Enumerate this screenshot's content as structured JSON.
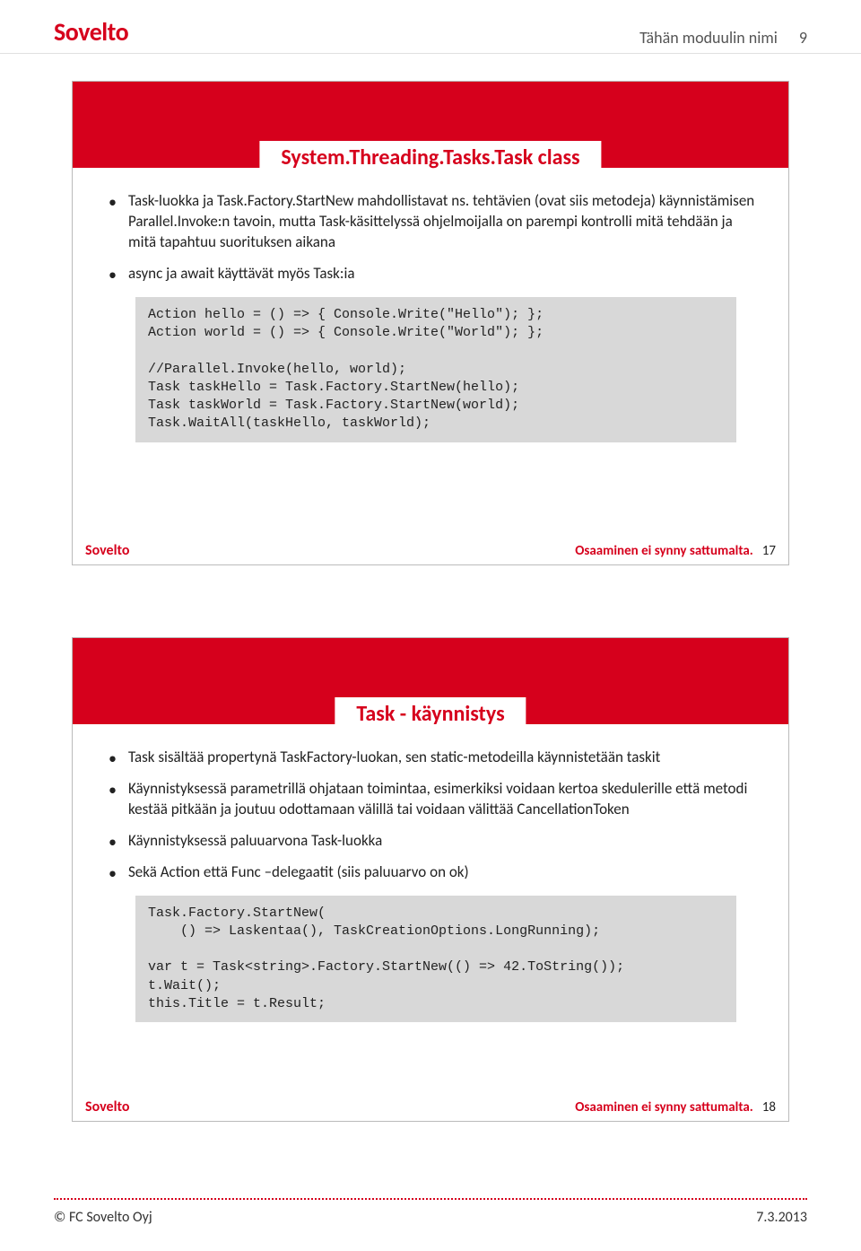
{
  "header": {
    "logo": "Sovelto",
    "module_label": "Tähän moduulin nimi",
    "page_number": "9"
  },
  "slides": [
    {
      "title": "System.Threading.Tasks.Task class",
      "bullets": [
        "Task-luokka ja Task.Factory.StartNew mahdollistavat ns. tehtävien (ovat siis metodeja) käynnistämisen Parallel.Invoke:n tavoin, mutta Task-käsittelyssä ohjelmoijalla on parempi kontrolli mitä tehdään ja mitä tapahtuu suorituksen aikana",
        "async ja await käyttävät myös Task:ia"
      ],
      "code": "Action hello = () => { Console.Write(\"Hello\"); };\nAction world = () => { Console.Write(\"World\"); };\n\n//Parallel.Invoke(hello, world);\nTask taskHello = Task.Factory.StartNew(hello);\nTask taskWorld = Task.Factory.StartNew(world);\nTask.WaitAll(taskHello, taskWorld);",
      "footer_logo": "Sovelto",
      "footer_slogan": "Osaaminen ei synny sattumalta.",
      "slide_number": "17"
    },
    {
      "title": "Task - käynnistys",
      "bullets": [
        "Task sisältää propertynä TaskFactory-luokan, sen static-metodeilla käynnistetään taskit",
        "Käynnistyksessä parametrillä ohjataan toimintaa, esimerkiksi voidaan kertoa skedulerille että metodi kestää pitkään ja joutuu odottamaan välillä tai voidaan välittää CancellationToken",
        "Käynnistyksessä paluuarvona Task-luokka",
        "Sekä Action että Func –delegaatit (siis paluuarvo on ok)"
      ],
      "code": "Task.Factory.StartNew(\n    () => Laskentaa(), TaskCreationOptions.LongRunning);\n\nvar t = Task<string>.Factory.StartNew(() => 42.ToString());\nt.Wait();\nthis.Title = t.Result;",
      "footer_logo": "Sovelto",
      "footer_slogan": "Osaaminen ei synny sattumalta.",
      "slide_number": "18"
    }
  ],
  "footer": {
    "copyright": "© FC Sovelto Oyj",
    "date": "7.3.2013"
  }
}
